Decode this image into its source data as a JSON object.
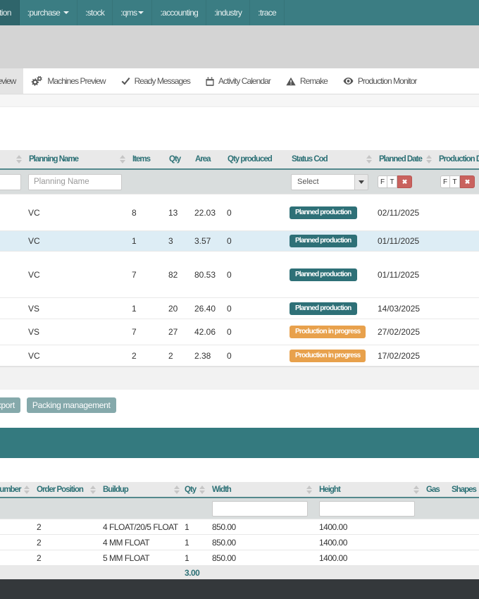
{
  "theme": {
    "navbar_teal": "#3b7d83",
    "navbar_active_teal": "#2f656b",
    "header_text_teal": "#2d7176",
    "badge_planned_teal": "#2e7077",
    "badge_progress_orange": "#e8a14c",
    "button_teal_gray": "#85a9ab",
    "clear_filter_red": "#c9625e",
    "selected_row_blue": "#ddedf5",
    "section_band_teal": "#347a7f",
    "footer_dark": "#34383b"
  },
  "navbar": {
    "items": [
      {
        "label": ":production",
        "active": true,
        "caret": false
      },
      {
        "label": ":purchase",
        "active": false,
        "caret": true
      },
      {
        "label": ":stock",
        "active": false,
        "caret": false
      },
      {
        "label": ":qms",
        "active": false,
        "caret": true
      },
      {
        "label": ":accounting",
        "active": false,
        "caret": false
      },
      {
        "label": ":industry",
        "active": false,
        "caret": false
      },
      {
        "label": ":trace",
        "active": false,
        "caret": false
      }
    ]
  },
  "tabs": [
    {
      "label": "Orders Preview",
      "icon": "list-icon",
      "active": true
    },
    {
      "label": "Machines Preview",
      "icon": "gears-icon",
      "active": false
    },
    {
      "label": "Ready Messages",
      "icon": "check-icon",
      "active": false
    },
    {
      "label": "Activity Calendar",
      "icon": "calendar-icon",
      "active": false
    },
    {
      "label": "Remake",
      "icon": "warning-icon",
      "active": false
    },
    {
      "label": "Production Monitor",
      "icon": "eye-icon",
      "active": false
    }
  ],
  "planning_table": {
    "columns": {
      "number": "",
      "planning_name": "Planning Name",
      "items": "Items",
      "qty": "Qty",
      "area": "Area",
      "qty_produced": "Qty produced",
      "status_cod": "Status Cod",
      "planned_date": "Planned Date",
      "production_date": "Production Date"
    },
    "filter": {
      "planning_name_placeholder": "Planning Name",
      "status_select_value": "Select",
      "date_from_label": "F",
      "date_to_label": "T",
      "clear_label": "✖"
    },
    "rows": [
      {
        "planning_name": "VC",
        "items": "8",
        "qty": "13",
        "area": "22.03",
        "qty_produced": "0",
        "status": "Planned production",
        "status_variant": "planned",
        "planned_date": "02/11/2025"
      },
      {
        "planning_name": "VC",
        "items": "1",
        "qty": "3",
        "area": "3.57",
        "qty_produced": "0",
        "status": "Planned production",
        "status_variant": "planned",
        "planned_date": "01/11/2025"
      },
      {
        "planning_name": "VC",
        "items": "7",
        "qty": "82",
        "area": "80.53",
        "qty_produced": "0",
        "status": "Planned production",
        "status_variant": "planned",
        "planned_date": "01/11/2025"
      },
      {
        "planning_name": "VS",
        "items": "1",
        "qty": "20",
        "area": "26.40",
        "qty_produced": "0",
        "status": "Planned production",
        "status_variant": "planned",
        "planned_date": "14/03/2025"
      },
      {
        "planning_name": "VS",
        "items": "7",
        "qty": "27",
        "area": "42.06",
        "qty_produced": "0",
        "status": "Production in progress",
        "status_variant": "progress",
        "planned_date": "27/02/2025"
      },
      {
        "planning_name": "VC",
        "items": "2",
        "qty": "2",
        "area": "2.38",
        "qty_produced": "0",
        "status": "Production in progress",
        "status_variant": "progress",
        "planned_date": "17/02/2025"
      }
    ]
  },
  "actions": {
    "export_label": "Export",
    "packing_label": "Packing management"
  },
  "glass_table": {
    "columns": {
      "number": "Number",
      "order_position": "Order Position",
      "buildup": "Buildup",
      "qty": "Qty",
      "width": "Width",
      "height": "Height",
      "gas": "Gas",
      "shapes": "Shapes"
    },
    "rows": [
      {
        "order_position": "2",
        "buildup": "4 FLOAT/20/5 FLOAT",
        "qty": "1",
        "width": "850.00",
        "height": "1400.00",
        "gas": "",
        "shapes": ""
      },
      {
        "order_position": "2",
        "buildup": "4 MM FLOAT",
        "qty": "1",
        "width": "850.00",
        "height": "1400.00",
        "gas": "",
        "shapes": ""
      },
      {
        "order_position": "2",
        "buildup": "5 MM FLOAT",
        "qty": "1",
        "width": "850.00",
        "height": "1400.00",
        "gas": "",
        "shapes": ""
      }
    ],
    "total_qty": "3.00"
  }
}
